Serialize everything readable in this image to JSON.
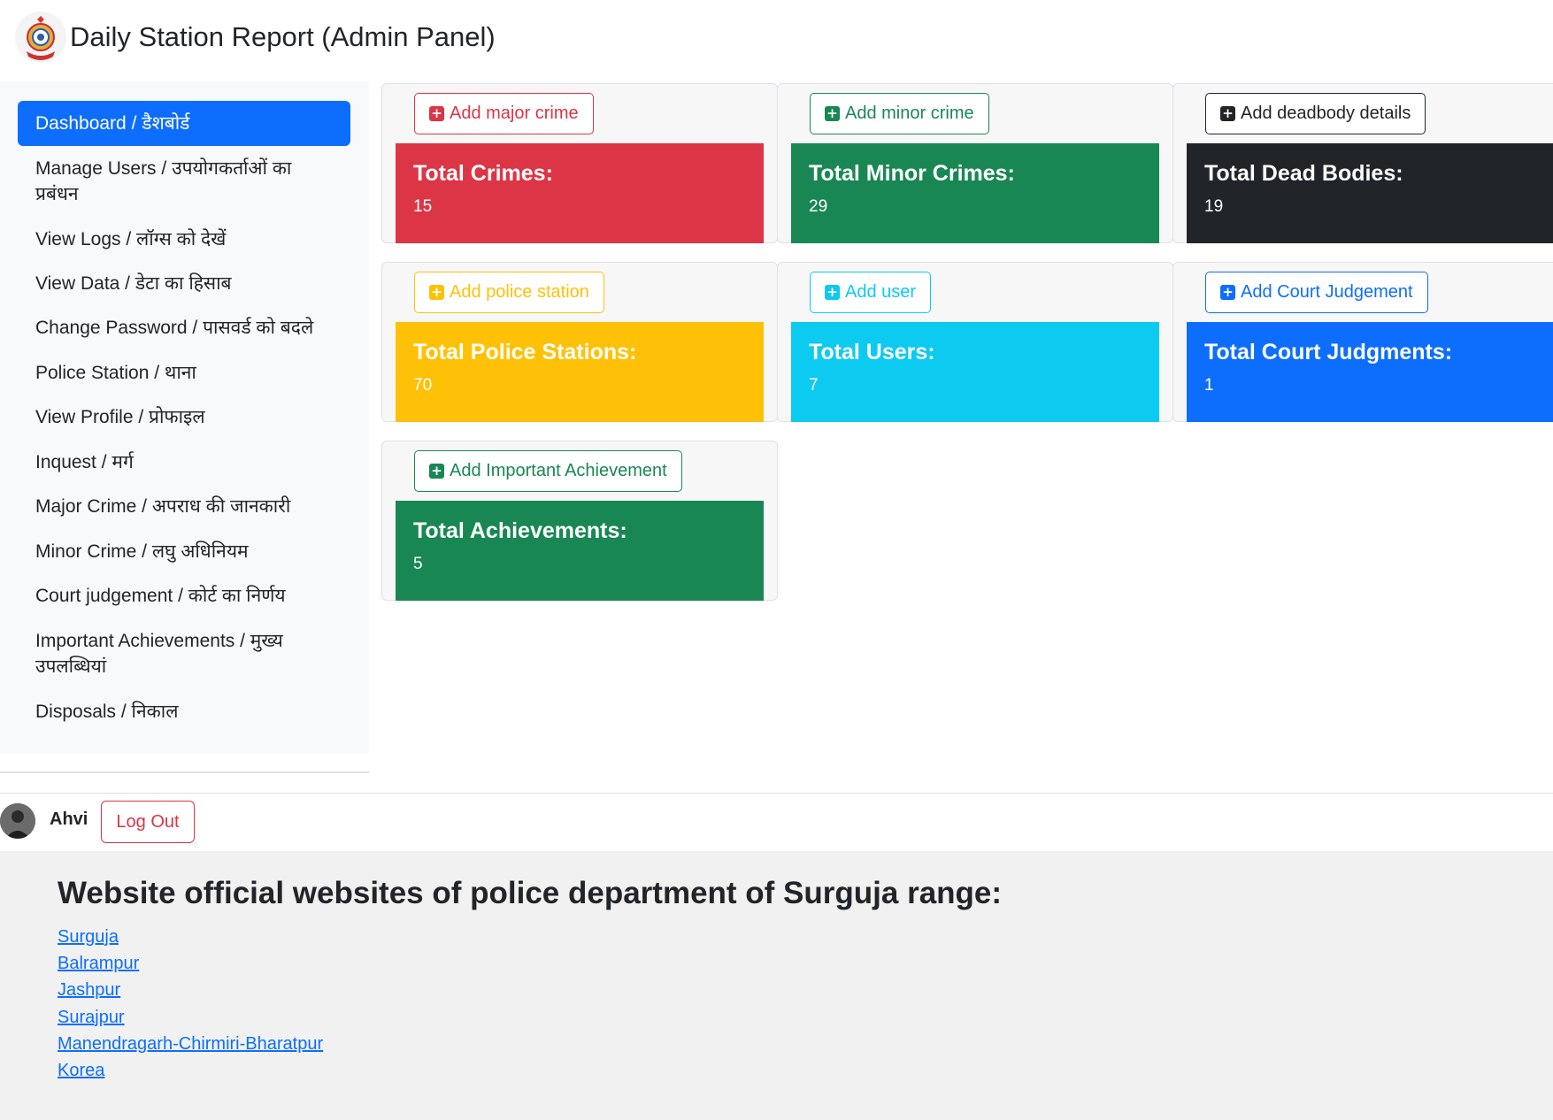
{
  "header": {
    "title": "Daily Station Report (Admin Panel)"
  },
  "sidebar": {
    "items": [
      {
        "label": "Dashboard / डैशबोर्ड",
        "active": true
      },
      {
        "label": "Manage Users / उपयोगकर्ताओं का प्रबंधन"
      },
      {
        "label": "View Logs / लॉग्स को देखें"
      },
      {
        "label": "View Data / डेटा का हिसाब"
      },
      {
        "label": "Change Password / पासवर्ड को बदले"
      },
      {
        "label": "Police Station / थाना"
      },
      {
        "label": "View Profile / प्रोफाइल"
      },
      {
        "label": "Inquest / मर्ग"
      },
      {
        "label": "Major Crime / अपराध की जानकारी"
      },
      {
        "label": "Minor Crime / लघु अधिनियम"
      },
      {
        "label": "Court judgement / कोर्ट का निर्णय"
      },
      {
        "label": "Important Achievements / मुख्य उपलब्धियां"
      },
      {
        "label": "Disposals / निकाल"
      }
    ]
  },
  "cards": [
    {
      "button": "Add major crime",
      "title": "Total Crimes:",
      "count": "15",
      "color": "#dc3545"
    },
    {
      "button": "Add minor crime",
      "title": "Total Minor Crimes:",
      "count": "29",
      "color": "#198754"
    },
    {
      "button": "Add deadbody details",
      "title": "Total Dead Bodies:",
      "count": "19",
      "color": "#212529"
    },
    {
      "button": "Add police station",
      "title": "Total Police Stations:",
      "count": "70",
      "color": "#ffc107"
    },
    {
      "button": "Add user",
      "title": "Total Users:",
      "count": "7",
      "color": "#0dcaf0"
    },
    {
      "button": "Add Court Judgement",
      "title": "Total Court Judgments:",
      "count": "1",
      "color": "#0d6efd"
    },
    {
      "button": "Add Important Achievement",
      "title": "Total Achievements:",
      "count": "5",
      "color": "#198754"
    }
  ],
  "user": {
    "name": "Ahvi",
    "logout_label": "Log Out"
  },
  "footer": {
    "title": "Website official websites of police department of Surguja range:",
    "links": [
      "Surguja",
      "Balrampur",
      "Jashpur",
      "Surajpur",
      "Manendragarh-Chirmiri-Bharatpur",
      "Korea"
    ]
  }
}
